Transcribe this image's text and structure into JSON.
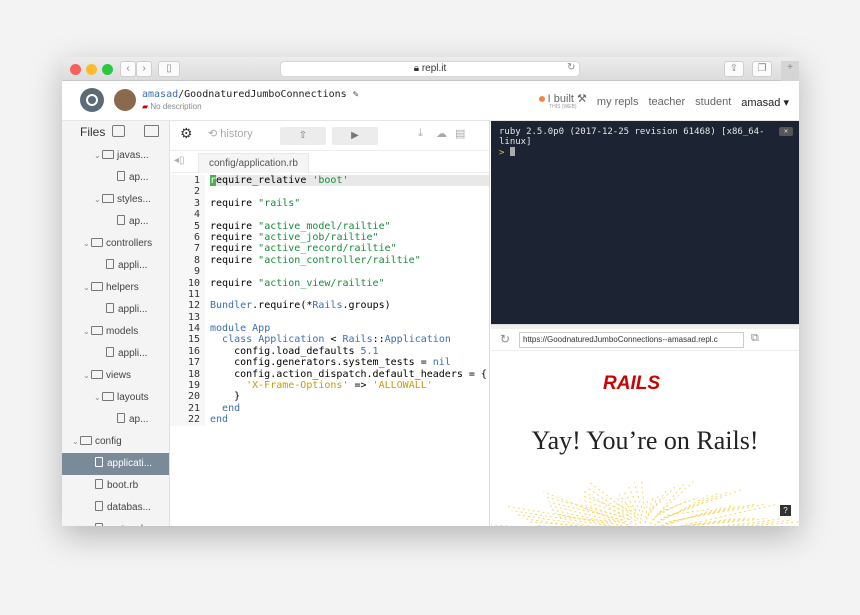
{
  "browser": {
    "url": "repl.it"
  },
  "header": {
    "username": "amasad",
    "repl_name": "/GoodnaturedJumboConnections",
    "description": "No description",
    "built_label": "I built",
    "built_sub": "THIS (WEB)",
    "nav": [
      "my repls",
      "teacher",
      "student"
    ],
    "user_menu": "amasad"
  },
  "files": {
    "title": "Files",
    "items": [
      {
        "label": "javas...",
        "type": "folder",
        "level": 1
      },
      {
        "label": "ap...",
        "type": "file",
        "level": 2
      },
      {
        "label": "styles...",
        "type": "folder",
        "level": 1
      },
      {
        "label": "ap...",
        "type": "file",
        "level": 2
      },
      {
        "label": "controllers",
        "type": "folder",
        "level": 0
      },
      {
        "label": "appli...",
        "type": "file",
        "level": 1
      },
      {
        "label": "helpers",
        "type": "folder",
        "level": 0
      },
      {
        "label": "appli...",
        "type": "file",
        "level": 1
      },
      {
        "label": "models",
        "type": "folder",
        "level": 0
      },
      {
        "label": "appli...",
        "type": "file",
        "level": 1
      },
      {
        "label": "views",
        "type": "folder",
        "level": 0
      },
      {
        "label": "layouts",
        "type": "folder",
        "level": 1
      },
      {
        "label": "ap...",
        "type": "file",
        "level": 2
      },
      {
        "label": "config",
        "type": "folder",
        "level": -1
      },
      {
        "label": "applicati...",
        "type": "file",
        "level": 0,
        "selected": true
      },
      {
        "label": "boot.rb",
        "type": "file",
        "level": 0
      },
      {
        "label": "databas...",
        "type": "file",
        "level": 0
      },
      {
        "label": "routes.rb",
        "type": "file",
        "level": 0
      }
    ]
  },
  "editor": {
    "history_label": "history",
    "tab": "config/application.rb",
    "line_numbers": [
      "1",
      "2",
      "3",
      "4",
      "5",
      "6",
      "7",
      "8",
      "9",
      "10",
      "11",
      "12",
      "13",
      "14",
      "15",
      "16",
      "17",
      "18",
      "19",
      "20",
      "21",
      "22"
    ]
  },
  "console": {
    "line1": "ruby 2.5.0p0 (2017-12-25 revision 61468) [x86_64-",
    "line2": "linux]",
    "prompt": ">"
  },
  "preview": {
    "url": "https://GoodnaturedJumboConnections--amasad.repl.c",
    "logo_text": "RAILS",
    "headline": "Yay! You’re on Rails!",
    "help": "?"
  }
}
